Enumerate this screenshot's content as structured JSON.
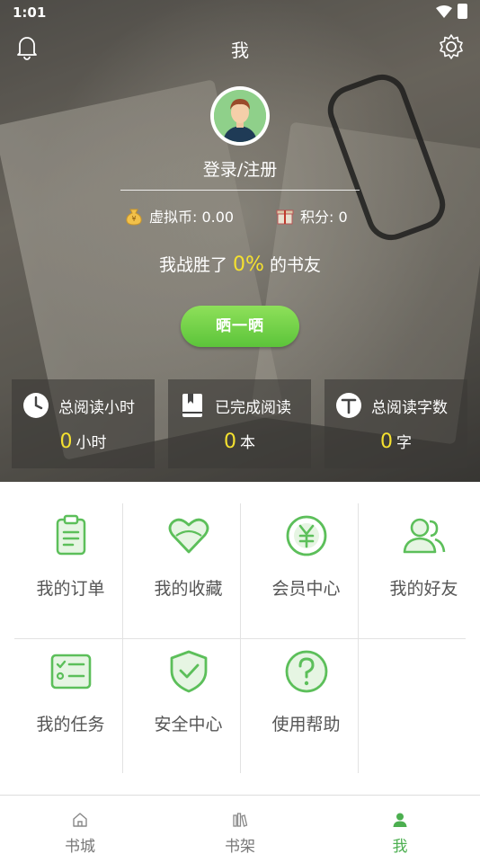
{
  "status_bar": {
    "time": "1:01"
  },
  "header": {
    "title": "我"
  },
  "profile": {
    "login_text": "登录/注册",
    "virtual_coin_label": "虚拟币: 0.00",
    "points_label": "积分: 0",
    "beat_prefix": "我战胜了",
    "beat_percent": "0%",
    "beat_suffix": "的书友",
    "share_button": "晒一晒"
  },
  "stats": [
    {
      "title": "总阅读小时",
      "value": "0",
      "unit": "小时",
      "icon": "clock-icon"
    },
    {
      "title": "已完成阅读",
      "value": "0",
      "unit": "本",
      "icon": "book-icon"
    },
    {
      "title": "总阅读字数",
      "value": "0",
      "unit": "字",
      "icon": "text-icon"
    }
  ],
  "menu": [
    {
      "label": "我的订单",
      "icon": "order-icon"
    },
    {
      "label": "我的收藏",
      "icon": "heart-icon"
    },
    {
      "label": "会员中心",
      "icon": "yuan-icon"
    },
    {
      "label": "我的好友",
      "icon": "friends-icon"
    },
    {
      "label": "我的任务",
      "icon": "task-icon"
    },
    {
      "label": "安全中心",
      "icon": "shield-icon"
    },
    {
      "label": "使用帮助",
      "icon": "help-icon"
    }
  ],
  "bottom_nav": [
    {
      "label": "书城",
      "icon": "home-icon",
      "active": false
    },
    {
      "label": "书架",
      "icon": "bookshelf-icon",
      "active": false
    },
    {
      "label": "我",
      "icon": "person-icon",
      "active": true
    }
  ],
  "colors": {
    "accent_green": "#4caf50",
    "highlight_yellow": "#f5e12f",
    "icon_green": "#5cbf5a"
  }
}
